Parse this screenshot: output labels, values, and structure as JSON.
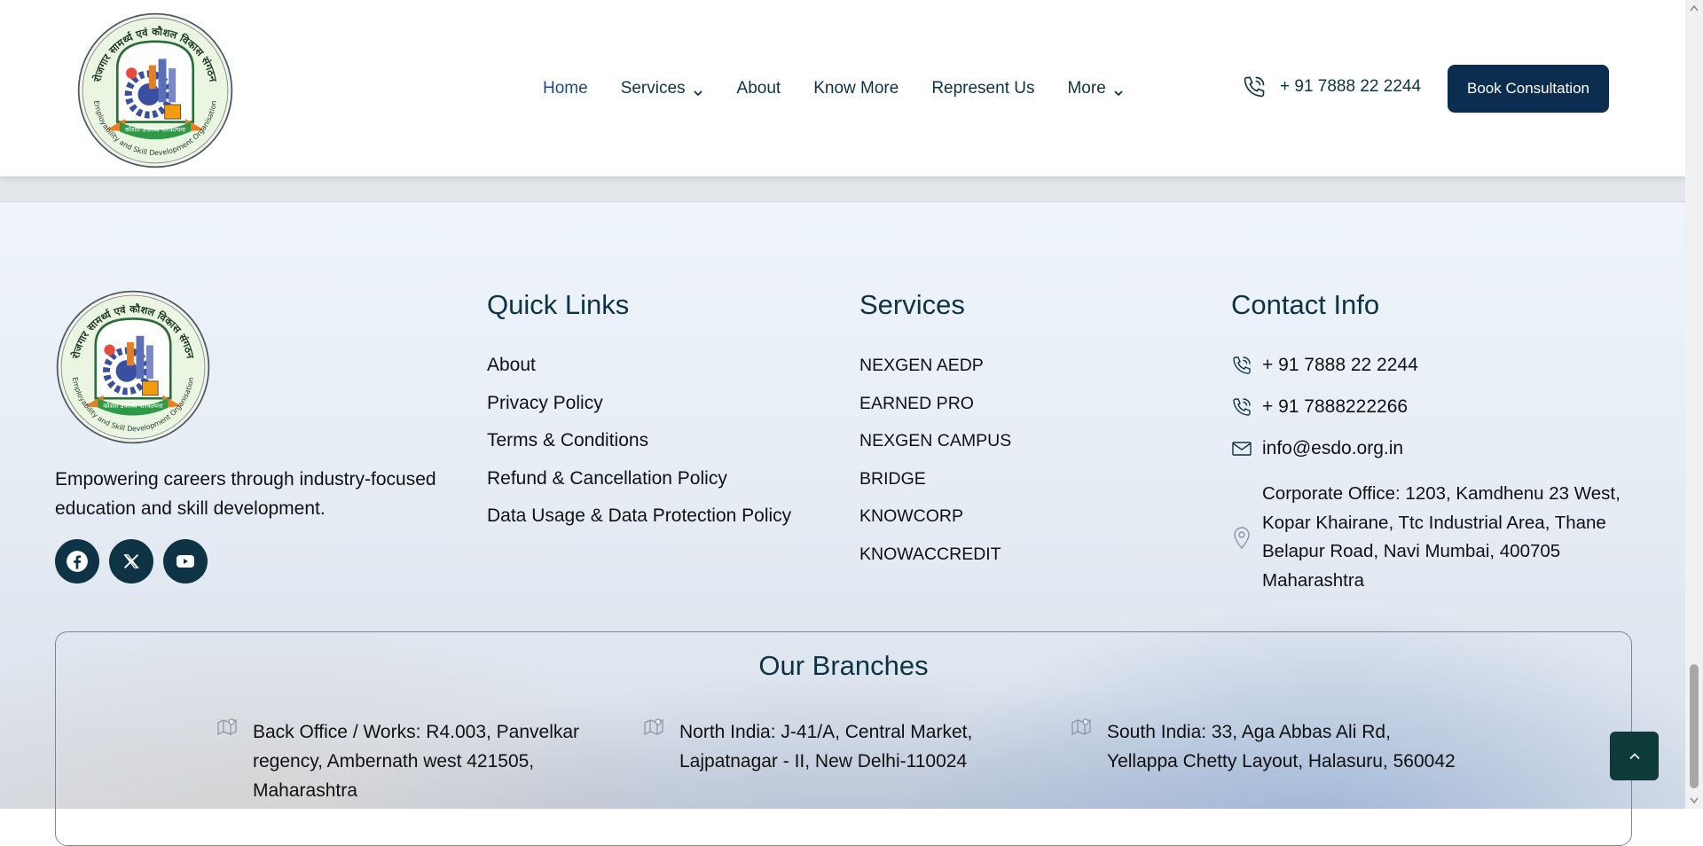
{
  "logo": {
    "hindi_text": "रोजगार सामर्थ्य एवं कौशल विकास संगठन",
    "english_text": "Employability and Skill Development Organisation",
    "banner_text": "कौशल उपलब्ध परिकल्पना"
  },
  "nav": {
    "items": [
      {
        "label": "Home",
        "dropdown": false,
        "active": true
      },
      {
        "label": "Services",
        "dropdown": true,
        "active": false
      },
      {
        "label": "About",
        "dropdown": false,
        "active": false
      },
      {
        "label": "Know More",
        "dropdown": false,
        "active": false
      },
      {
        "label": "Represent Us",
        "dropdown": false,
        "active": false
      },
      {
        "label": "More",
        "dropdown": true,
        "active": false
      }
    ],
    "phone": "+ 91 7888 22 2244",
    "cta": "Book Consultation"
  },
  "footer": {
    "tagline": "Empowering careers through industry-focused education and skill development.",
    "social_icons": [
      "facebook-icon",
      "x-twitter-icon",
      "youtube-icon"
    ],
    "quick_links": {
      "title": "Quick Links",
      "items": [
        "About",
        "Privacy Policy",
        "Terms & Conditions",
        "Refund & Cancellation Policy",
        "Data Usage & Data Protection Policy"
      ]
    },
    "services": {
      "title": "Services",
      "items": [
        "NEXGEN AEDP",
        "EARNED PRO",
        "NEXGEN CAMPUS",
        "BRIDGE",
        "KNOWCORP",
        "KNOWACCREDIT"
      ]
    },
    "contact": {
      "title": "Contact Info",
      "phone1": "+ 91 7888 22 2244",
      "phone2": "+ 91 7888222266",
      "email": "info@esdo.org.in",
      "address": "Corporate Office: 1203, Kamdhenu 23 West, Kopar Khairane, Ttc Industrial Area, Thane Belapur Road, Navi Mumbai, 400705 Maharashtra"
    },
    "branches": {
      "title": "Our Branches",
      "items": [
        "Back Office / Works: R4.003, Panvelkar regency, Ambernath west 421505, Maharashtra",
        "North India: J-41/A, Central Market, Lajpatnagar - II, New Delhi-110024",
        "South India: 33, Aga Abbas Ali Rd, Yellappa Chetty Layout, Halasuru, 560042"
      ]
    }
  },
  "colors": {
    "brand_dark": "#0b2d4f",
    "heading": "#0e3345",
    "scroll_top_bg": "#0c3b39"
  }
}
